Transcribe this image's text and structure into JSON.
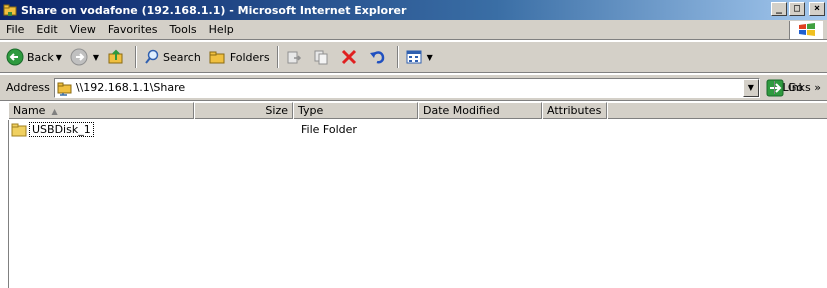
{
  "window": {
    "title": "Share on vodafone (192.168.1.1) - Microsoft Internet Explorer",
    "minimize": "_",
    "maximize": "□",
    "close": "×"
  },
  "menu": [
    "File",
    "Edit",
    "View",
    "Favorites",
    "Tools",
    "Help"
  ],
  "toolbar": {
    "back_label": "Back",
    "search_label": "Search",
    "folders_label": "Folders"
  },
  "address": {
    "label": "Address",
    "value": "\\\\192.168.1.1\\Share",
    "go_label": "Go",
    "links_label": "Links »"
  },
  "columns": {
    "name": "Name",
    "size": "Size",
    "type": "Type",
    "date_modified": "Date Modified",
    "attributes": "Attributes"
  },
  "files": [
    {
      "name": "USBDisk_1",
      "size": "",
      "type": "File Folder",
      "date_modified": "",
      "attributes": ""
    }
  ],
  "colors": {
    "titlebar_start": "#0a246a",
    "titlebar_end": "#a6caf0",
    "chrome": "#d4d0c8",
    "folder": "#f0d060"
  }
}
